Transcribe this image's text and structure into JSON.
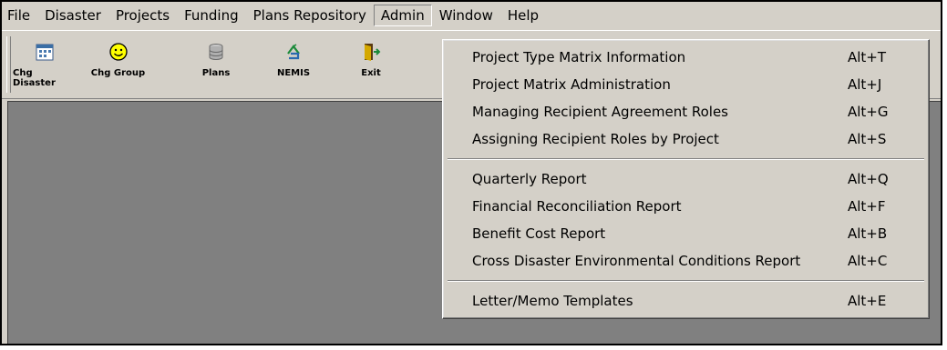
{
  "menubar": {
    "items": [
      "File",
      "Disaster",
      "Projects",
      "Funding",
      "Plans Repository",
      "Admin",
      "Window",
      "Help"
    ],
    "active": "Admin"
  },
  "toolbar": {
    "buttons": [
      {
        "label": "Chg Disaster",
        "icon": "calendar-icon"
      },
      {
        "label": "Chg Group",
        "icon": "smiley-icon"
      },
      {
        "label": "Plans",
        "icon": "database-icon"
      },
      {
        "label": "NEMIS",
        "icon": "nemis-recycle-icon"
      },
      {
        "label": "Exit",
        "icon": "exit-door-icon"
      }
    ]
  },
  "admin_menu": {
    "groups": [
      [
        {
          "label": "Project Type Matrix Information",
          "shortcut": "Alt+T"
        },
        {
          "label": "Project Matrix Administration",
          "shortcut": "Alt+J"
        },
        {
          "label": "Managing Recipient Agreement Roles",
          "shortcut": "Alt+G"
        },
        {
          "label": "Assigning Recipient Roles by Project",
          "shortcut": "Alt+S"
        }
      ],
      [
        {
          "label": "Quarterly Report",
          "shortcut": "Alt+Q"
        },
        {
          "label": "Financial Reconciliation Report",
          "shortcut": "Alt+F"
        },
        {
          "label": "Benefit Cost Report",
          "shortcut": "Alt+B"
        },
        {
          "label": "Cross Disaster Environmental Conditions Report",
          "shortcut": "Alt+C"
        }
      ],
      [
        {
          "label": "Letter/Memo Templates",
          "shortcut": "Alt+E"
        }
      ]
    ]
  },
  "colors": {
    "chrome": "#d4d0c8",
    "workspace": "#808080",
    "border": "#000000"
  }
}
